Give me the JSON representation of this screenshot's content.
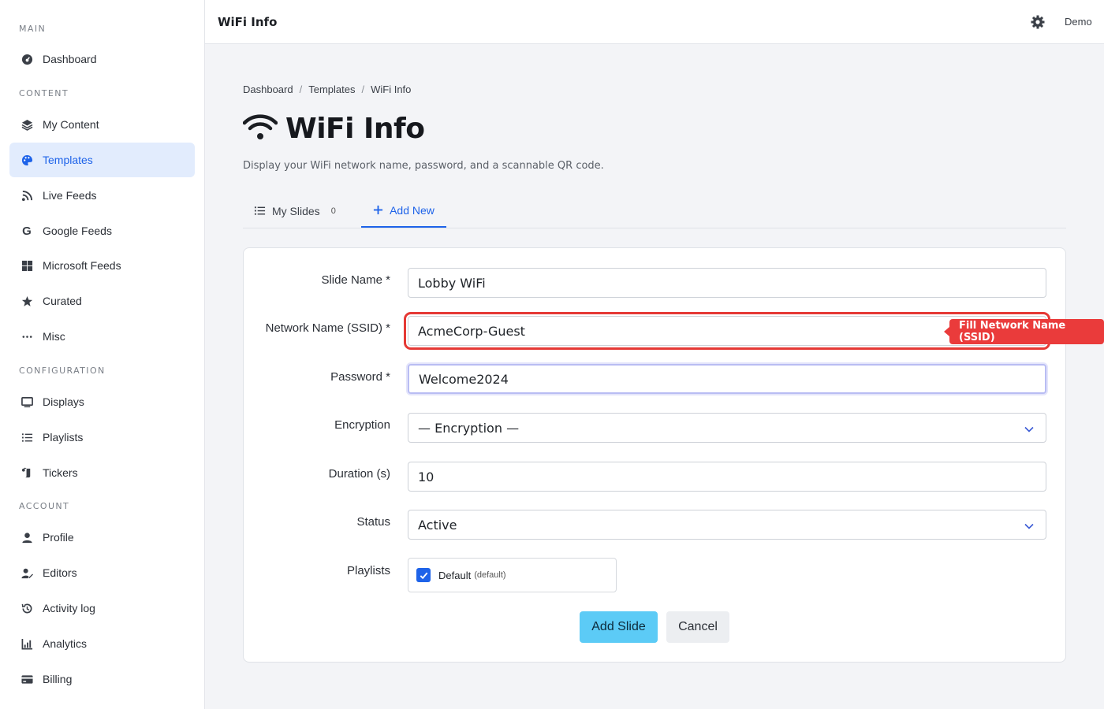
{
  "sidebar": {
    "sections": {
      "main": "MAIN",
      "content": "CONTENT",
      "configuration": "CONFIGURATION",
      "account": "ACCOUNT"
    },
    "items": {
      "dashboard": "Dashboard",
      "my_content": "My Content",
      "templates": "Templates",
      "live_feeds": "Live Feeds",
      "google_feeds": "Google Feeds",
      "microsoft_feeds": "Microsoft Feeds",
      "curated": "Curated",
      "misc": "Misc",
      "displays": "Displays",
      "playlists": "Playlists",
      "tickers": "Tickers",
      "profile": "Profile",
      "editors": "Editors",
      "activity_log": "Activity log",
      "analytics": "Analytics",
      "billing": "Billing"
    },
    "active_item": "Templates"
  },
  "header": {
    "title": "WiFi Info",
    "user": "Demo"
  },
  "breadcrumb": [
    "Dashboard",
    "Templates",
    "WiFi Info"
  ],
  "page": {
    "title": "WiFi Info",
    "subtitle": "Display your WiFi network name, password, and a scannable QR code."
  },
  "tabs": {
    "my_slides": "My Slides",
    "my_slides_count": "0",
    "add_new": "Add New"
  },
  "form": {
    "slide_name_label": "Slide Name *",
    "slide_name_value": "Lobby WiFi",
    "ssid_label": "Network Name (SSID) *",
    "ssid_value": "AcmeCorp-Guest",
    "password_label": "Password *",
    "password_value": "Welcome2024",
    "encryption_label": "Encryption",
    "encryption_value": "— Encryption —",
    "duration_label": "Duration (s)",
    "duration_value": "10",
    "status_label": "Status",
    "status_value": "Active",
    "playlists_label": "Playlists",
    "playlist_name": "Default",
    "playlist_tag": "(default)",
    "playlist_checked": true,
    "submit": "Add Slide",
    "cancel": "Cancel"
  },
  "tooltip": "Fill Network Name (SSID)",
  "colors": {
    "accent": "#1e63e9",
    "primary_button": "#5ccbf6",
    "highlight": "#e53935",
    "active_nav_bg": "#e2ecfd"
  }
}
